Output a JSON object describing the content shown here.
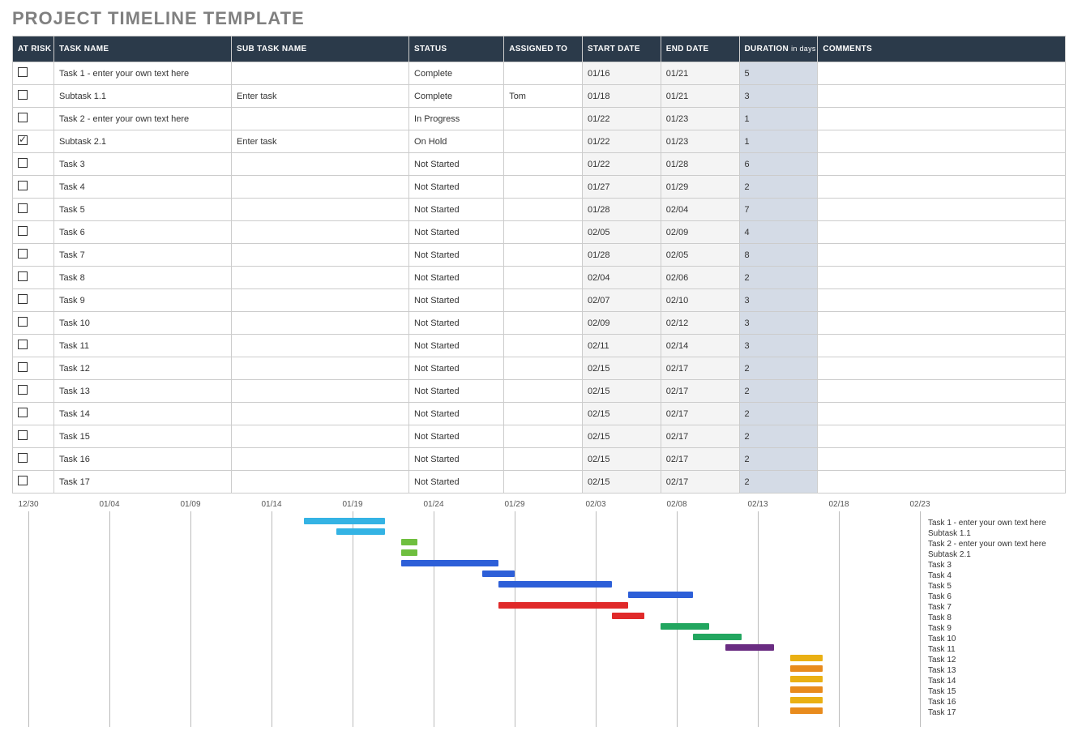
{
  "title": "PROJECT TIMELINE TEMPLATE",
  "columns": {
    "risk": "AT RISK",
    "task": "TASK NAME",
    "subtask": "SUB TASK NAME",
    "status": "STATUS",
    "assigned": "ASSIGNED TO",
    "start": "START DATE",
    "end": "END DATE",
    "duration": "DURATION",
    "duration_sub": "in days",
    "comments": "COMMENTS"
  },
  "rows": [
    {
      "risk": false,
      "task": "Task 1 - enter your own text here",
      "subtask": "",
      "status": "Complete",
      "assigned": "",
      "start": "01/16",
      "end": "01/21",
      "duration": "5",
      "comments": ""
    },
    {
      "risk": false,
      "task": "Subtask 1.1",
      "subtask": "Enter task",
      "status": "Complete",
      "assigned": "Tom",
      "start": "01/18",
      "end": "01/21",
      "duration": "3",
      "comments": ""
    },
    {
      "risk": false,
      "task": "Task 2 - enter your own text here",
      "subtask": "",
      "status": "In Progress",
      "assigned": "",
      "start": "01/22",
      "end": "01/23",
      "duration": "1",
      "comments": ""
    },
    {
      "risk": true,
      "task": "Subtask 2.1",
      "subtask": "Enter task",
      "status": "On Hold",
      "assigned": "",
      "start": "01/22",
      "end": "01/23",
      "duration": "1",
      "comments": ""
    },
    {
      "risk": false,
      "task": "Task 3",
      "subtask": "",
      "status": "Not Started",
      "assigned": "",
      "start": "01/22",
      "end": "01/28",
      "duration": "6",
      "comments": ""
    },
    {
      "risk": false,
      "task": "Task 4",
      "subtask": "",
      "status": "Not Started",
      "assigned": "",
      "start": "01/27",
      "end": "01/29",
      "duration": "2",
      "comments": ""
    },
    {
      "risk": false,
      "task": "Task 5",
      "subtask": "",
      "status": "Not Started",
      "assigned": "",
      "start": "01/28",
      "end": "02/04",
      "duration": "7",
      "comments": ""
    },
    {
      "risk": false,
      "task": "Task 6",
      "subtask": "",
      "status": "Not Started",
      "assigned": "",
      "start": "02/05",
      "end": "02/09",
      "duration": "4",
      "comments": ""
    },
    {
      "risk": false,
      "task": "Task 7",
      "subtask": "",
      "status": "Not Started",
      "assigned": "",
      "start": "01/28",
      "end": "02/05",
      "duration": "8",
      "comments": ""
    },
    {
      "risk": false,
      "task": "Task 8",
      "subtask": "",
      "status": "Not Started",
      "assigned": "",
      "start": "02/04",
      "end": "02/06",
      "duration": "2",
      "comments": ""
    },
    {
      "risk": false,
      "task": "Task 9",
      "subtask": "",
      "status": "Not Started",
      "assigned": "",
      "start": "02/07",
      "end": "02/10",
      "duration": "3",
      "comments": ""
    },
    {
      "risk": false,
      "task": "Task 10",
      "subtask": "",
      "status": "Not Started",
      "assigned": "",
      "start": "02/09",
      "end": "02/12",
      "duration": "3",
      "comments": ""
    },
    {
      "risk": false,
      "task": "Task 11",
      "subtask": "",
      "status": "Not Started",
      "assigned": "",
      "start": "02/11",
      "end": "02/14",
      "duration": "3",
      "comments": ""
    },
    {
      "risk": false,
      "task": "Task 12",
      "subtask": "",
      "status": "Not Started",
      "assigned": "",
      "start": "02/15",
      "end": "02/17",
      "duration": "2",
      "comments": ""
    },
    {
      "risk": false,
      "task": "Task 13",
      "subtask": "",
      "status": "Not Started",
      "assigned": "",
      "start": "02/15",
      "end": "02/17",
      "duration": "2",
      "comments": ""
    },
    {
      "risk": false,
      "task": "Task 14",
      "subtask": "",
      "status": "Not Started",
      "assigned": "",
      "start": "02/15",
      "end": "02/17",
      "duration": "2",
      "comments": ""
    },
    {
      "risk": false,
      "task": "Task 15",
      "subtask": "",
      "status": "Not Started",
      "assigned": "",
      "start": "02/15",
      "end": "02/17",
      "duration": "2",
      "comments": ""
    },
    {
      "risk": false,
      "task": "Task 16",
      "subtask": "",
      "status": "Not Started",
      "assigned": "",
      "start": "02/15",
      "end": "02/17",
      "duration": "2",
      "comments": ""
    },
    {
      "risk": false,
      "task": "Task 17",
      "subtask": "",
      "status": "Not Started",
      "assigned": "",
      "start": "02/15",
      "end": "02/17",
      "duration": "2",
      "comments": ""
    }
  ],
  "chart_data": {
    "type": "bar",
    "title": "",
    "x_axis": {
      "min": "12/30",
      "max": "02/23",
      "ticks": [
        "12/30",
        "01/04",
        "01/09",
        "01/14",
        "01/19",
        "01/24",
        "01/29",
        "02/03",
        "02/08",
        "02/13",
        "02/18",
        "02/23"
      ]
    },
    "series": [
      {
        "name": "Task 1 - enter your own text here",
        "start": "01/16",
        "end": "01/21",
        "color": "#34b3e4"
      },
      {
        "name": "Subtask 1.1",
        "start": "01/18",
        "end": "01/21",
        "color": "#34b3e4"
      },
      {
        "name": "Task 2 - enter your own text here",
        "start": "01/22",
        "end": "01/23",
        "color": "#6fbf3f"
      },
      {
        "name": "Subtask 2.1",
        "start": "01/22",
        "end": "01/23",
        "color": "#6fbf3f"
      },
      {
        "name": "Task 3",
        "start": "01/22",
        "end": "01/28",
        "color": "#2d5fd8"
      },
      {
        "name": "Task 4",
        "start": "01/27",
        "end": "01/29",
        "color": "#2d5fd8"
      },
      {
        "name": "Task 5",
        "start": "01/28",
        "end": "02/04",
        "color": "#2d5fd8"
      },
      {
        "name": "Task 6",
        "start": "02/05",
        "end": "02/09",
        "color": "#2d5fd8"
      },
      {
        "name": "Task 7",
        "start": "01/28",
        "end": "02/05",
        "color": "#e02a2a"
      },
      {
        "name": "Task 8",
        "start": "02/04",
        "end": "02/06",
        "color": "#e02a2a"
      },
      {
        "name": "Task 9",
        "start": "02/07",
        "end": "02/10",
        "color": "#22a65f"
      },
      {
        "name": "Task 10",
        "start": "02/09",
        "end": "02/12",
        "color": "#22a65f"
      },
      {
        "name": "Task 11",
        "start": "02/11",
        "end": "02/14",
        "color": "#6a2c82"
      },
      {
        "name": "Task 12",
        "start": "02/15",
        "end": "02/17",
        "color": "#eab013"
      },
      {
        "name": "Task 13",
        "start": "02/15",
        "end": "02/17",
        "color": "#e88b1d"
      },
      {
        "name": "Task 14",
        "start": "02/15",
        "end": "02/17",
        "color": "#eab013"
      },
      {
        "name": "Task 15",
        "start": "02/15",
        "end": "02/17",
        "color": "#e88b1d"
      },
      {
        "name": "Task 16",
        "start": "02/15",
        "end": "02/17",
        "color": "#eab013"
      },
      {
        "name": "Task 17",
        "start": "02/15",
        "end": "02/17",
        "color": "#e88b1d"
      }
    ]
  }
}
